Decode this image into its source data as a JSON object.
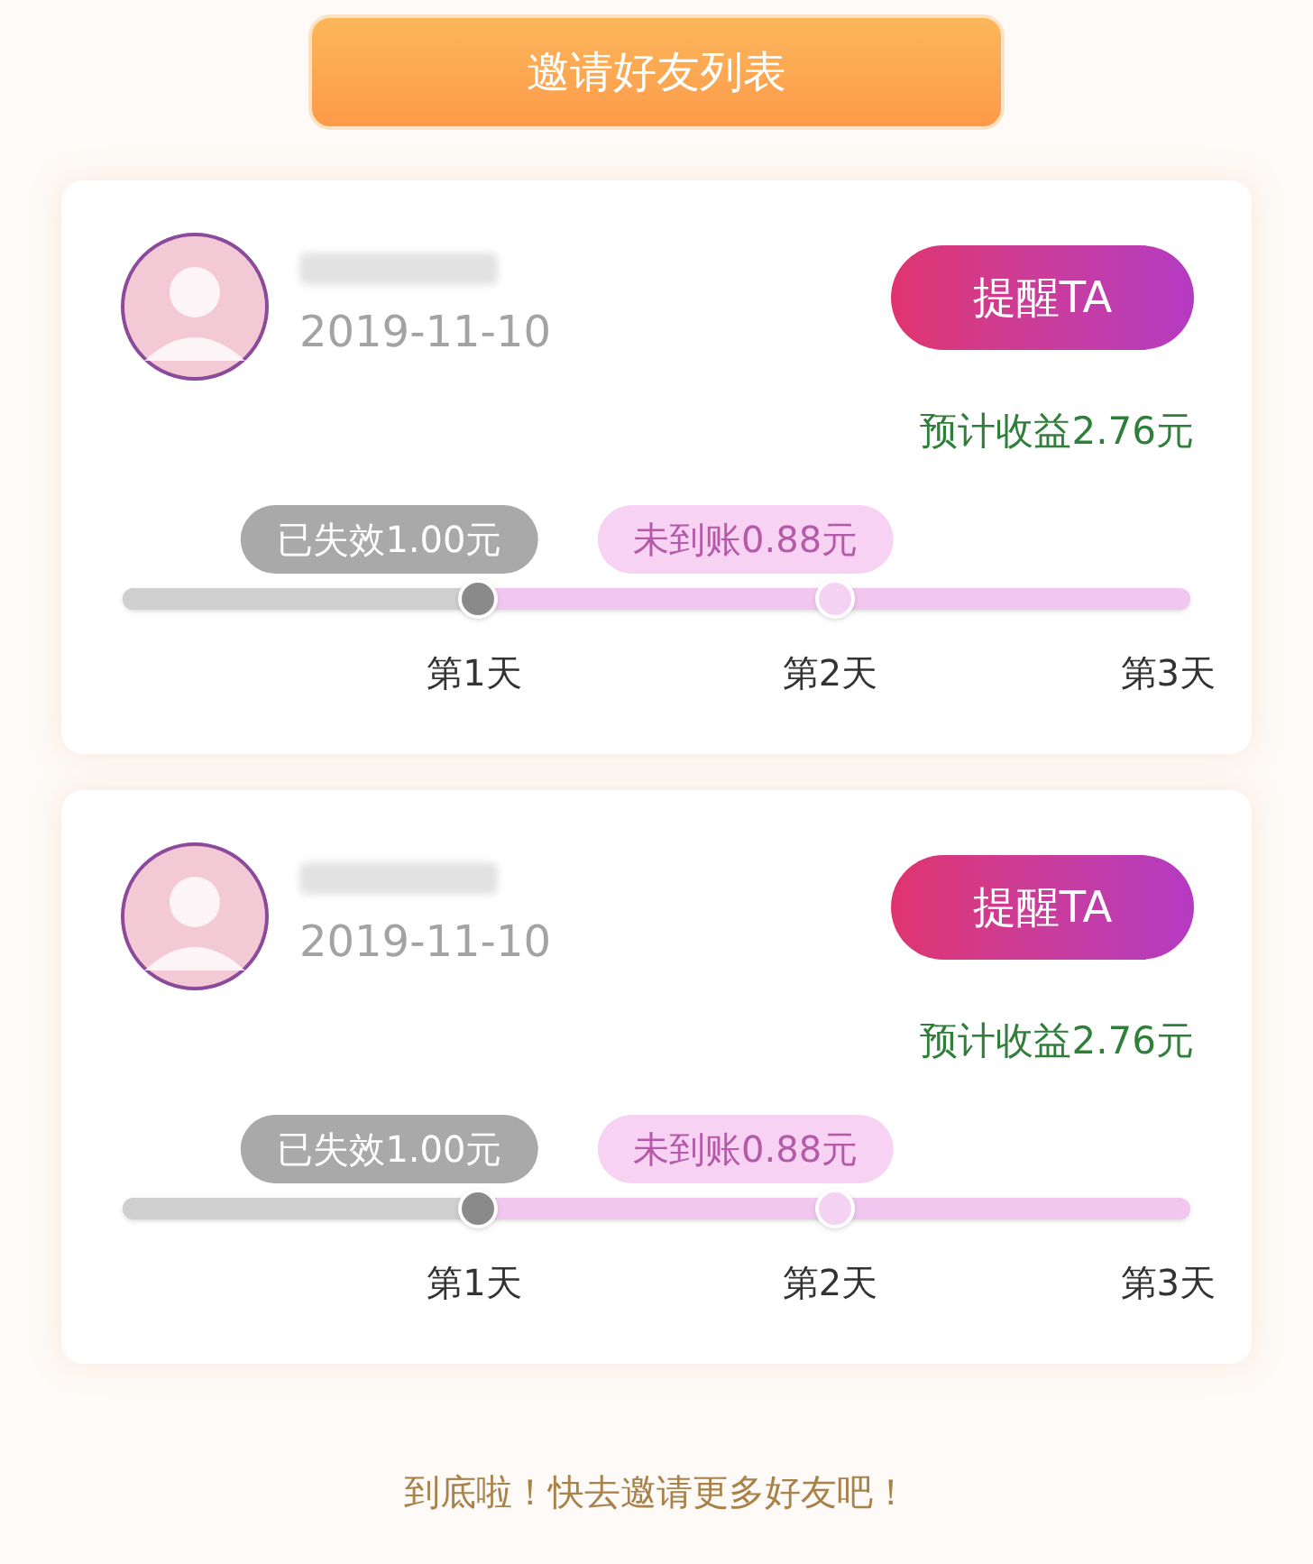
{
  "header": {
    "title": "邀请好友列表"
  },
  "friends": [
    {
      "date": "2019-11-10",
      "remind_button": "提醒TA",
      "expected_income": "预计收益2.76元",
      "level": 0.33,
      "milestones": [
        {
          "kind": "expired",
          "label": "已失效1.00元"
        },
        {
          "kind": "pending",
          "label": "未到账0.88元"
        }
      ],
      "days": [
        "第1天",
        "第2天",
        "第3天"
      ]
    },
    {
      "date": "2019-11-10",
      "remind_button": "提醒TA",
      "expected_income": "预计收益2.76元",
      "level": 0.33,
      "milestones": [
        {
          "kind": "expired",
          "label": "已失效1.00元"
        },
        {
          "kind": "pending",
          "label": "未到账0.88元"
        }
      ],
      "days": [
        "第1天",
        "第2天",
        "第3天"
      ]
    }
  ],
  "footer": {
    "text": "到底啦！快去邀请更多好友吧！"
  }
}
